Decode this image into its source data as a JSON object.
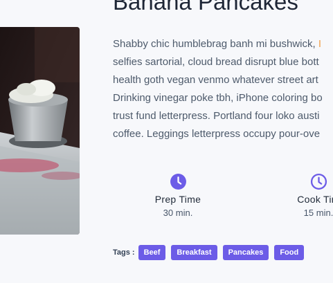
{
  "recipe": {
    "title": "Banana Pancakes",
    "description_lines": [
      "Shabby chic humblebrag banh mi bushwick, ",
      "selfies sartorial, cloud bread disrupt blue bott",
      "health goth vegan venmo whatever street art",
      "Drinking vinegar poke tbh, iPhone coloring bo",
      "trust fund letterpress. Portland four loko austi",
      "coffee. Leggings letterpress occupy pour-ove"
    ],
    "description_accent": "I",
    "prep": {
      "label": "Prep Time",
      "value": "30 min.",
      "icon": "clock-icon"
    },
    "cook": {
      "label": "Cook Tim",
      "value": "15 min.",
      "icon": "clock-icon"
    },
    "tags_label": "Tags :",
    "tags": [
      "Beef",
      "Breakfast",
      "Pancakes",
      "Food"
    ]
  },
  "colors": {
    "accent": "#6c5ce7",
    "background": "#f7f8fb",
    "title": "#1e2636",
    "body_text": "#4d5a6b"
  }
}
